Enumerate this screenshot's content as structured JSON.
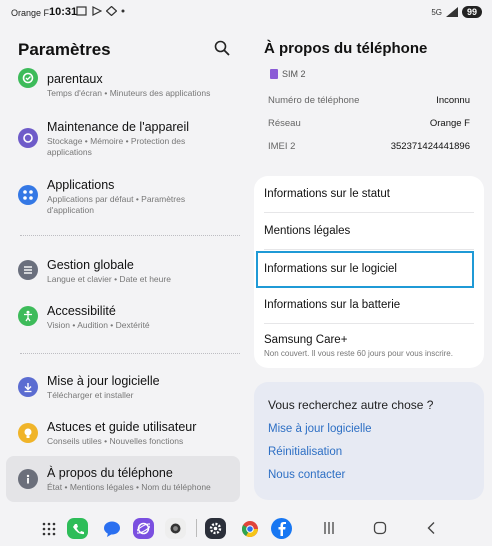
{
  "status_bar": {
    "carrier": "Orange F",
    "time": "10:31",
    "network": "5G",
    "battery": "99"
  },
  "left": {
    "title": "Paramètres",
    "items": [
      {
        "title": "parentaux",
        "subtitle": "Temps d'écran  •  Minuteurs des applications",
        "icon": "parental-icon",
        "color": "#3dbb5a"
      },
      {
        "title": "Maintenance de l'appareil",
        "subtitle": "Stockage  •  Mémoire  •  Protection des applications",
        "icon": "maintenance-icon",
        "color": "#6e5bc9"
      },
      {
        "title": "Applications",
        "subtitle": "Applications par défaut  •  Paramètres d'application",
        "icon": "apps-icon",
        "color": "#3478e5"
      },
      {
        "title": "Gestion globale",
        "subtitle": "Langue et clavier  •  Date et heure",
        "icon": "general-management-icon",
        "color": "#6a6f7d"
      },
      {
        "title": "Accessibilité",
        "subtitle": "Vision  •  Audition  •  Dextérité",
        "icon": "accessibility-icon",
        "color": "#3dbb5a"
      },
      {
        "title": "Mise à jour logicielle",
        "subtitle": "Télécharger et installer",
        "icon": "software-update-icon",
        "color": "#5b6cd1"
      },
      {
        "title": "Astuces et guide utilisateur",
        "subtitle": "Conseils utiles  •  Nouvelles fonctions",
        "icon": "tips-icon",
        "color": "#f0b429"
      },
      {
        "title": "À propos du téléphone",
        "subtitle": "État  •  Mentions légales  •  Nom du téléphone",
        "icon": "about-phone-icon",
        "color": "#6b6f7b"
      }
    ]
  },
  "right": {
    "title": "À propos du téléphone",
    "sim_label": "SIM 2",
    "info": [
      {
        "key": "Numéro de téléphone",
        "value": "Inconnu"
      },
      {
        "key": "Réseau",
        "value": "Orange F"
      },
      {
        "key": "IMEI 2",
        "value": "352371424441896"
      }
    ],
    "menu": [
      {
        "label": "Informations sur le statut"
      },
      {
        "label": "Mentions légales"
      },
      {
        "label": "Informations sur le logiciel"
      },
      {
        "label": "Informations sur la batterie"
      },
      {
        "label": "Samsung Care+",
        "subtitle": "Non couvert. Il vous reste 60 jours pour vous inscrire."
      }
    ],
    "help": {
      "title": "Vous recherchez autre chose ?",
      "links": [
        "Mise à jour logicielle",
        "Réinitialisation",
        "Nous contacter"
      ]
    }
  },
  "colors": {
    "accent_highlight": "#1f9ad6",
    "link": "#2d6fc4"
  },
  "dock_icons": [
    "apps-grid-icon",
    "phone-icon",
    "messages-icon",
    "internet-icon",
    "camera-icon",
    "settings-icon",
    "chrome-icon",
    "facebook-icon"
  ]
}
